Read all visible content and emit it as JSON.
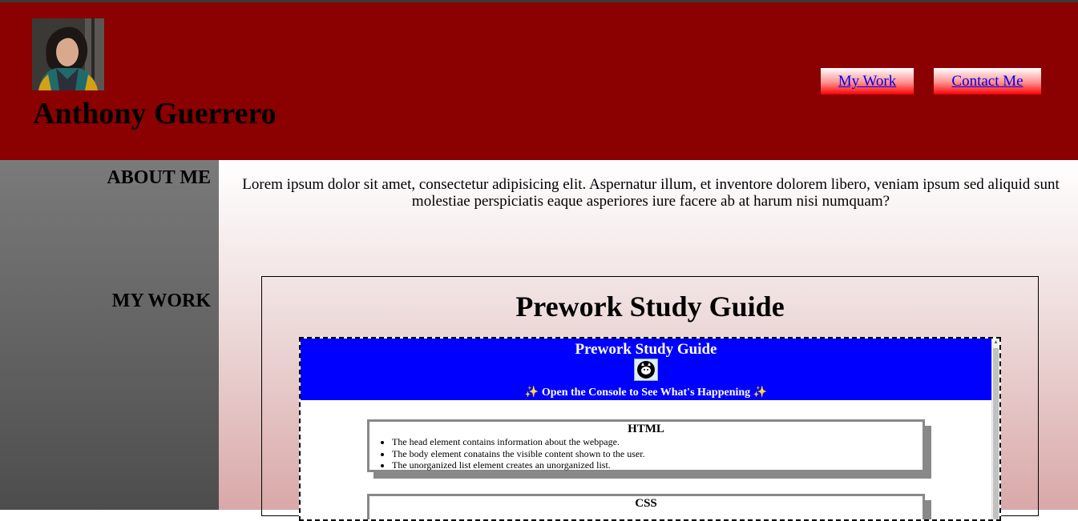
{
  "header": {
    "name": "Anthony Guerrero",
    "avatar_alt": "profile photo",
    "nav": [
      {
        "label": "My Work"
      },
      {
        "label": "Contact Me"
      }
    ]
  },
  "sidebar": {
    "about_heading": "ABOUT ME",
    "work_heading": "MY WORK"
  },
  "about": {
    "text": "Lorem ipsum dolor sit amet, consectetur adipisicing elit. Aspernatur illum, et inventore dolorem libero, veniam ipsum sed aliquid sunt molestiae perspiciatis eaque asperiores iure facere ab at harum nisi numquam?"
  },
  "work": {
    "card_title": "Prework Study Guide",
    "preview": {
      "title": "Prework Study Guide",
      "icon": "cat-icon",
      "banner_icon": "sparkles-icon",
      "banner_text": "Open the Console to See What's Happening",
      "sections": [
        {
          "title": "HTML",
          "items": [
            "The head element contains information about the webpage.",
            "The body element conatains the visible content shown to the user.",
            "The unorganized list element creates an unorganized list."
          ]
        },
        {
          "title": "CSS",
          "items": []
        }
      ]
    }
  },
  "colors": {
    "header_bg": "#8b0000",
    "preview_header_bg": "#0000ff",
    "link": "#0000ee"
  }
}
